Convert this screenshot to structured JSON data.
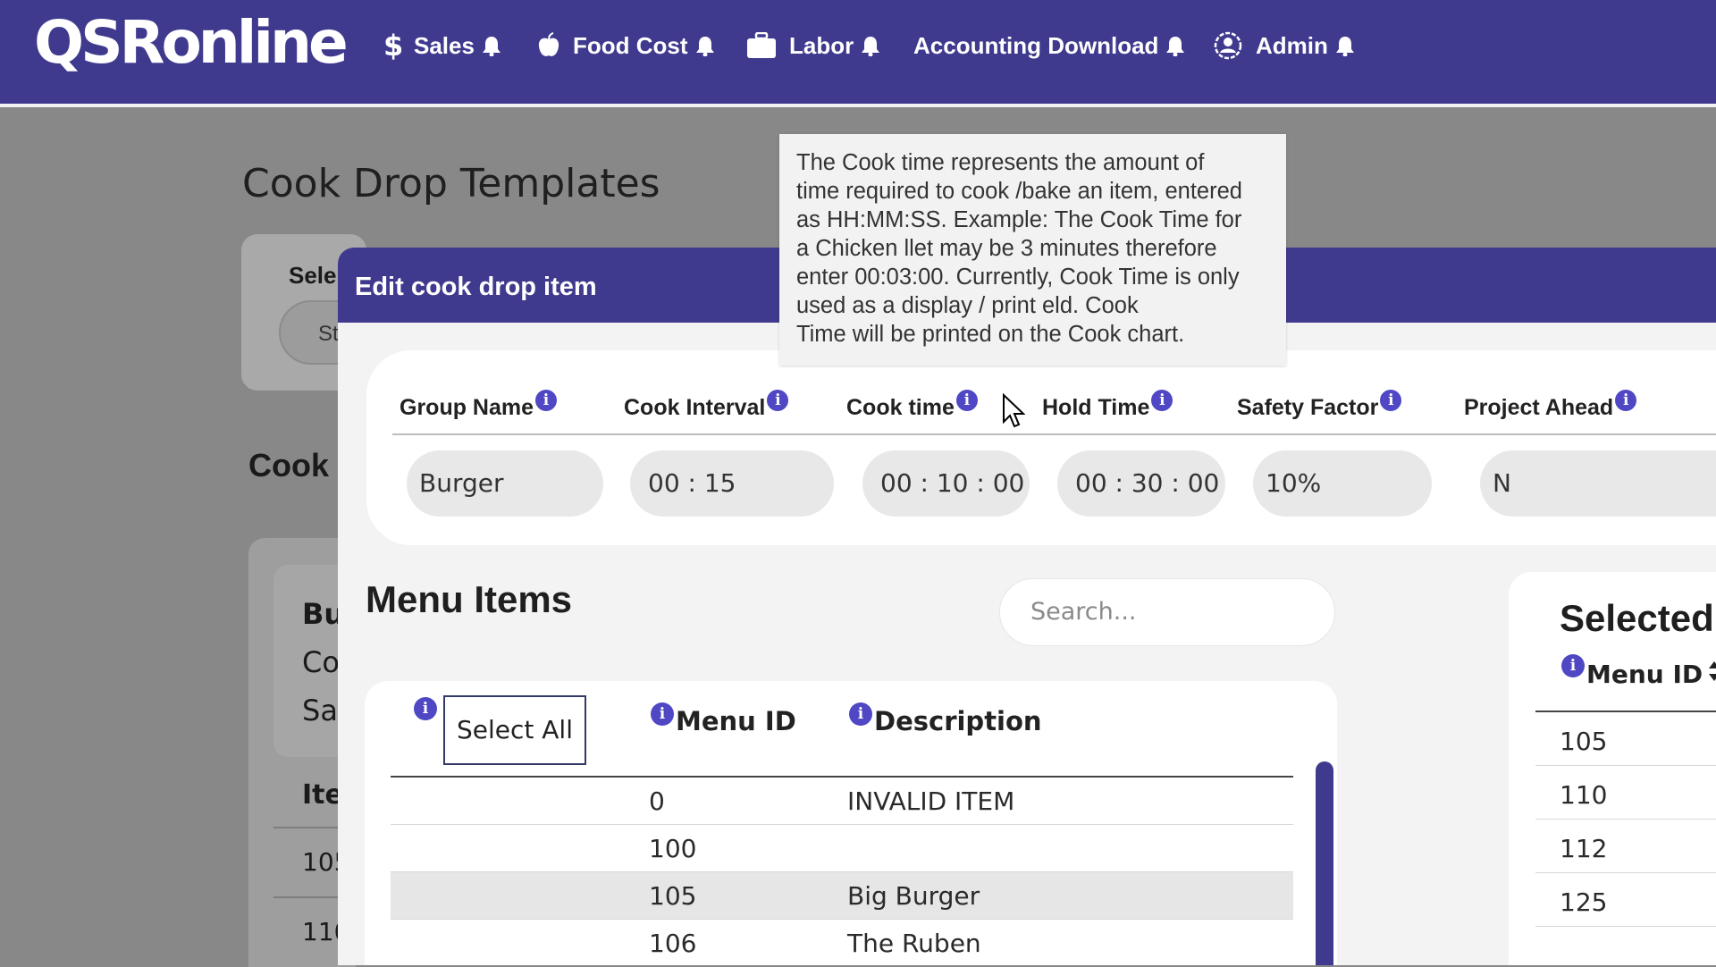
{
  "app": {
    "logo": "QSRonline"
  },
  "nav": [
    {
      "label": "Sales",
      "icon": "dollar-icon"
    },
    {
      "label": "Food Cost",
      "icon": "apple-icon"
    },
    {
      "label": "Labor",
      "icon": "briefcase-icon"
    },
    {
      "label": "Accounting Download",
      "icon": ""
    },
    {
      "label": "Admin",
      "icon": "admin-icon"
    }
  ],
  "background": {
    "page_title": "Cook Drop Templates",
    "select_label": "Sele",
    "select_value": "St",
    "cook_heading": "Cook",
    "group_lines": [
      "Bu",
      "Co",
      "Sa"
    ],
    "items_header": "Ite",
    "rows": [
      "105",
      "110"
    ]
  },
  "modal": {
    "title": "Edit cook drop item",
    "fields": [
      {
        "label": "Group Name",
        "value": "Burger"
      },
      {
        "label": "Cook Interval",
        "value": "00 : 15"
      },
      {
        "label": "Cook time",
        "value": "00 : 10 : 00"
      },
      {
        "label": "Hold Time",
        "value": "00 : 30 : 00"
      },
      {
        "label": "Safety Factor",
        "value": "10%"
      },
      {
        "label": "Project Ahead",
        "value": "N"
      }
    ],
    "menu_items": {
      "title": "Menu Items",
      "search_placeholder": "Search...",
      "select_all": "Select All",
      "col_menu_id": "Menu ID",
      "col_description": "Description",
      "rows": [
        {
          "id": "0",
          "description": "INVALID ITEM"
        },
        {
          "id": "100",
          "description": ""
        },
        {
          "id": "105",
          "description": "Big Burger"
        },
        {
          "id": "106",
          "description": "The Ruben"
        }
      ]
    },
    "selected": {
      "title": "Selected",
      "col_menu_id": "Menu ID",
      "rows": [
        "105",
        "110",
        "112",
        "125"
      ]
    }
  },
  "tooltip": {
    "lines": [
      "The Cook time represents the amount of",
      "time required to cook /bake an item, entered",
      "as HH:MM:SS. Example: The Cook Time for",
      "a Chicken llet may be 3 minutes therefore",
      "enter 00:03:00. Currently, Cook Time is only",
      "used as a display / print eld. Cook",
      "Time will be printed on the Cook chart."
    ]
  },
  "colors": {
    "brand": "#3f3a8e",
    "info_icon": "#4f47c4"
  }
}
